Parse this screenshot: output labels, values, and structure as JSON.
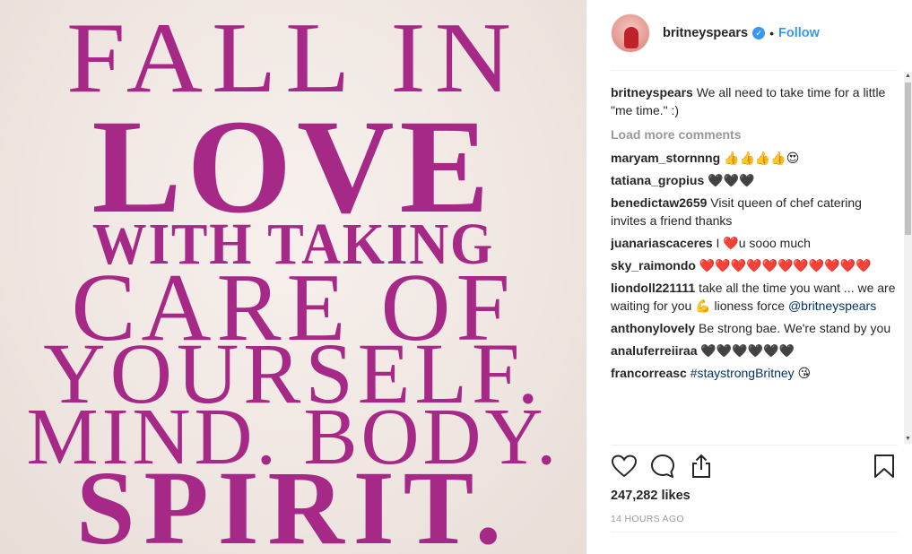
{
  "post_image": {
    "lines": [
      "FALL IN",
      "LOVE",
      "WITH TAKING",
      "CARE OF",
      "YOURSELF.",
      "MIND. BODY.",
      "SPIRIT."
    ]
  },
  "header": {
    "username": "britneyspears",
    "verified_icon": "verified-badge-icon",
    "separator": "•",
    "follow_label": "Follow"
  },
  "caption": {
    "user": "britneyspears",
    "text": "We all need to take time for a little \"me time.\" :)"
  },
  "load_more_label": "Load more comments",
  "comments": [
    {
      "user": "maryam_stornnng",
      "text": "👍👍👍👍😍"
    },
    {
      "user": "tatiana_gropius",
      "text": "🖤🖤🖤"
    },
    {
      "user": "benedictaw2659",
      "text": "Visit queen of chef catering invites a friend thanks"
    },
    {
      "user": "juanariascaceres",
      "text": "I ❤️u sooo much"
    },
    {
      "user": "sky_raimondo",
      "text": "❤️❤️❤️❤️❤️❤️❤️❤️❤️❤️❤️"
    },
    {
      "user": "liondoll221111",
      "text": "take all the time you want ... we are waiting for you 💪 lioness force ",
      "mention": "@britneyspears"
    },
    {
      "user": "anthonylovely",
      "text": "Be strong bae. We're stand by you"
    },
    {
      "user": "analuferreiiraa",
      "text": "🖤🖤🖤🖤🖤🖤"
    },
    {
      "user": "francorreasc",
      "hashtag": "#staystrongBritney",
      "text": " 😘"
    }
  ],
  "actions": {
    "like_icon": "heart-icon",
    "comment_icon": "comment-bubble-icon",
    "share_icon": "share-icon",
    "save_icon": "bookmark-icon"
  },
  "likes": "247,282 likes",
  "timestamp": "14 HOURS AGO"
}
